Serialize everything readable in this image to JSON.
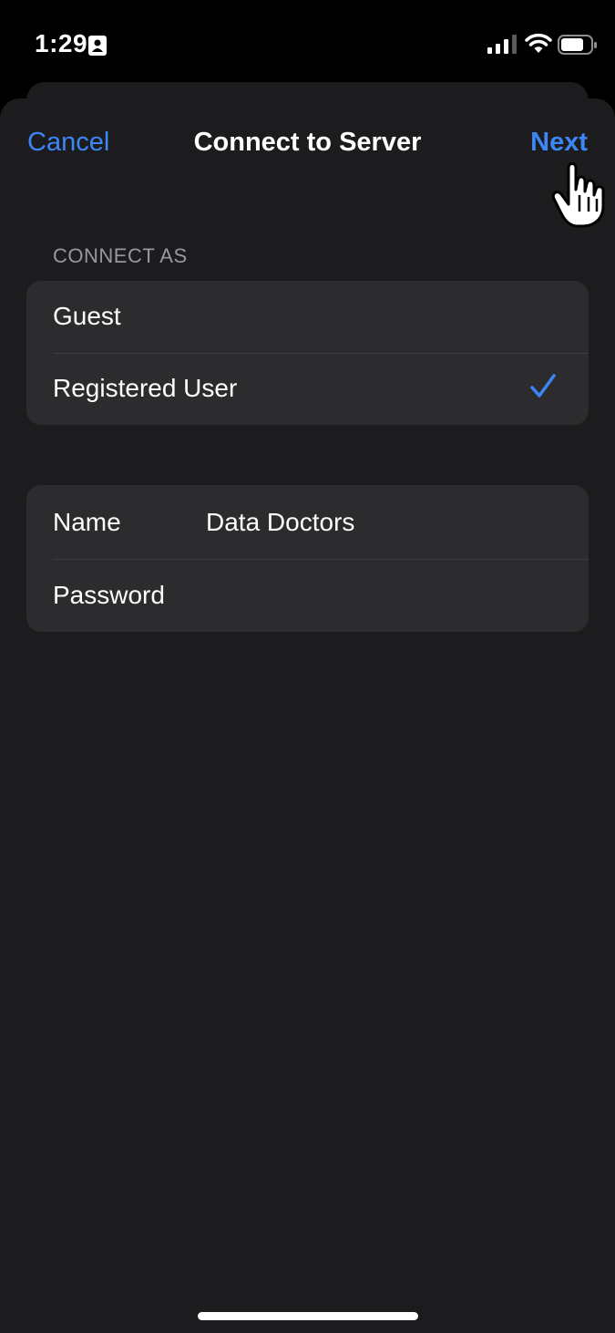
{
  "status_bar": {
    "time": "1:29",
    "icons": [
      "contact-card-icon",
      "cellular-signal-icon",
      "wifi-icon",
      "battery-icon"
    ]
  },
  "nav": {
    "cancel_label": "Cancel",
    "title": "Connect to Server",
    "next_label": "Next"
  },
  "connect_as": {
    "header": "CONNECT AS",
    "options": [
      {
        "label": "Guest",
        "selected": false
      },
      {
        "label": "Registered User",
        "selected": true
      }
    ]
  },
  "credentials": {
    "name_label": "Name",
    "name_value": "Data Doctors",
    "password_label": "Password",
    "password_value": ""
  },
  "colors": {
    "accent": "#3d86f6",
    "sheet_background": "#1c1c1e",
    "group_background": "#2c2c2e",
    "secondary_text": "#98989e"
  }
}
